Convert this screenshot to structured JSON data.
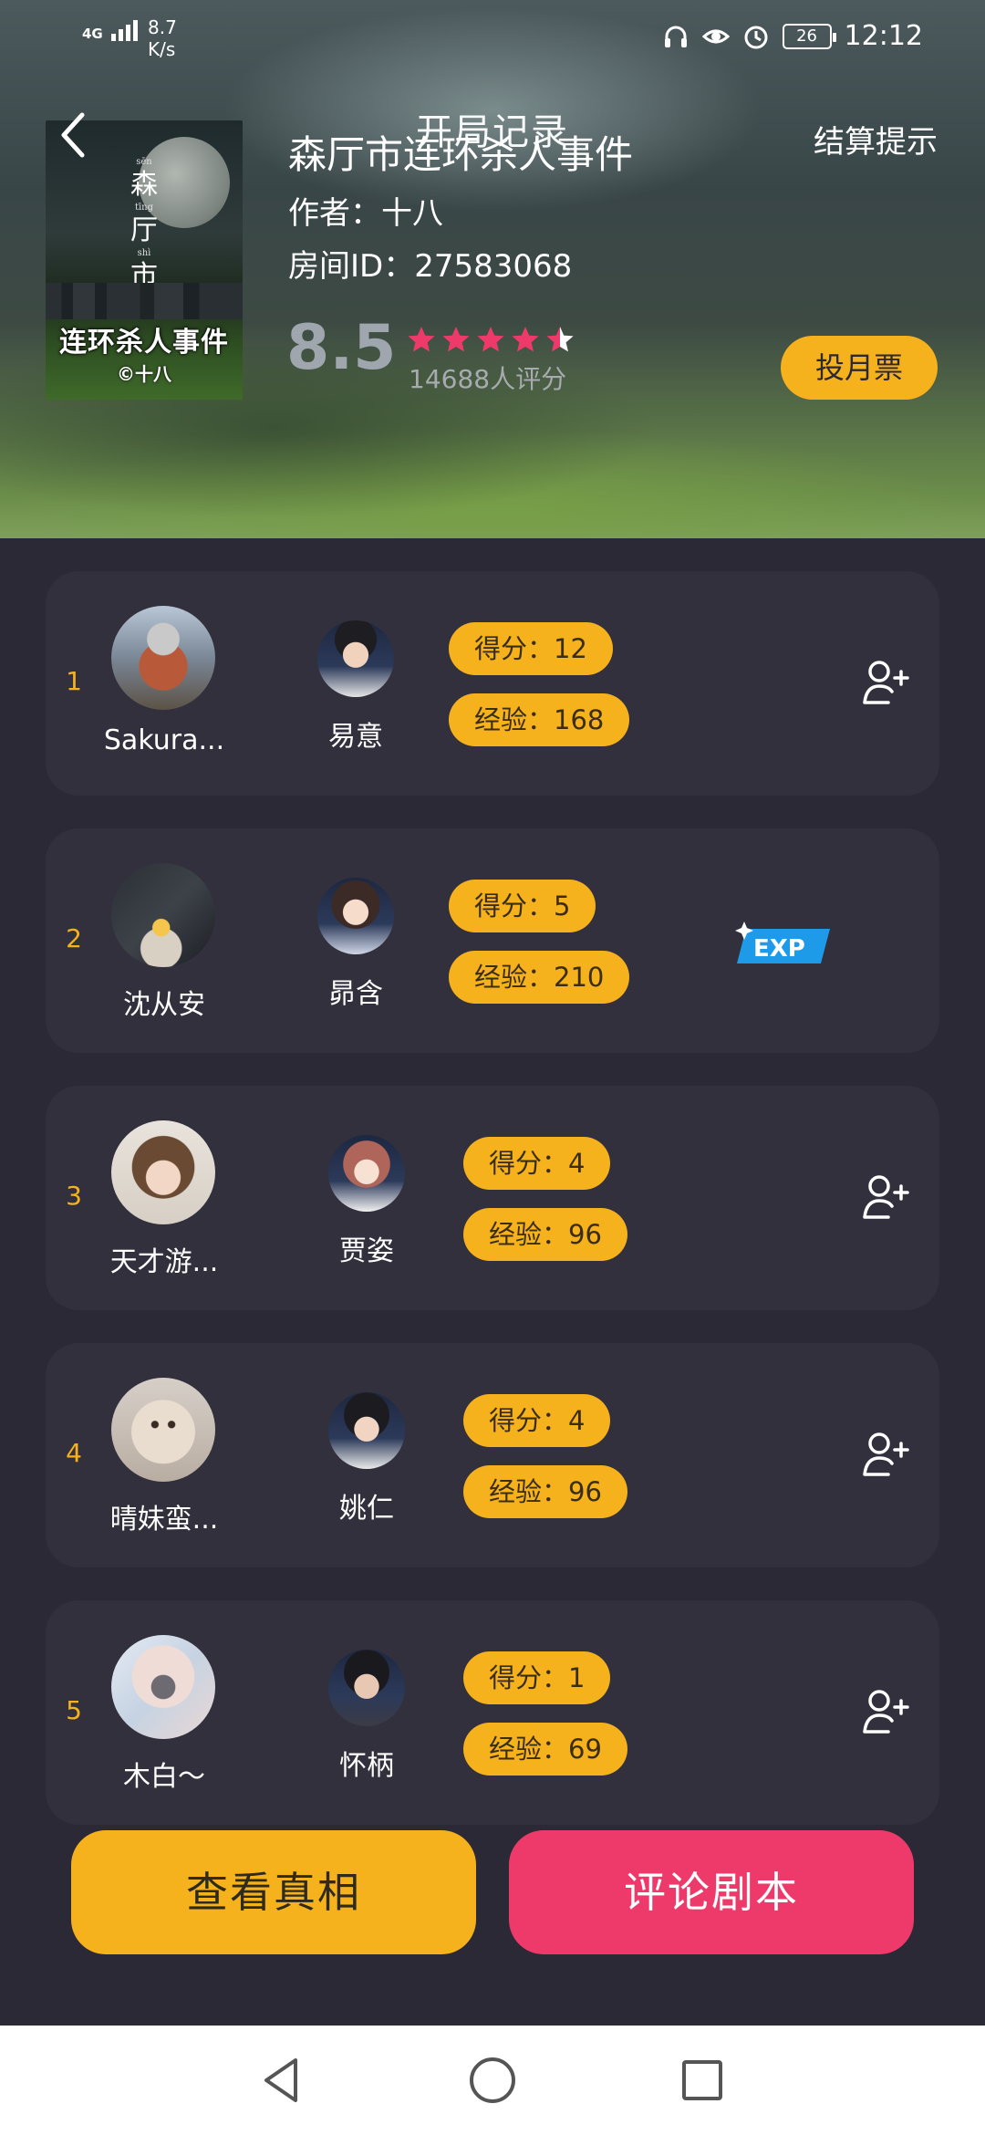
{
  "status_bar": {
    "network": "4G",
    "speed_value": "8.7",
    "speed_unit": "K/s",
    "battery": "26",
    "time": "12:12"
  },
  "header": {
    "title": "开局记录",
    "settle_link": "结算提示"
  },
  "book": {
    "cover_title": "连环杀人事件",
    "cover_vertical": [
      "森",
      "厅",
      "市"
    ],
    "cover_pinyin": [
      "sēn",
      "tīng",
      "shì"
    ],
    "cover_author": "©十八",
    "title": "森厅市连环杀人事件",
    "author": "作者：十八",
    "room_id": "房间ID：27583068",
    "rating": "8.5",
    "rating_stars": 4.5,
    "rating_count": "14688人评分",
    "vote_button": "投月票"
  },
  "players": [
    {
      "rank": "1",
      "player_name": "Sakura...",
      "role_name": "易意",
      "score": "得分：12",
      "exp": "经验：168",
      "action": "add-friend"
    },
    {
      "rank": "2",
      "player_name": "沈从安",
      "role_name": "昴含",
      "score": "得分：5",
      "exp": "经验：210",
      "action": "exp-badge",
      "badge": "EXP"
    },
    {
      "rank": "3",
      "player_name": "天才游...",
      "role_name": "贾姿",
      "score": "得分：4",
      "exp": "经验：96",
      "action": "add-friend"
    },
    {
      "rank": "4",
      "player_name": "晴妹蛮...",
      "role_name": "姚仁",
      "score": "得分：4",
      "exp": "经验：96",
      "action": "add-friend"
    },
    {
      "rank": "5",
      "player_name": "木白～",
      "role_name": "怀柄",
      "score": "得分：1",
      "exp": "经验：69",
      "action": "add-friend"
    }
  ],
  "buttons": {
    "view_truth": "查看真相",
    "review_script": "评论剧本"
  },
  "colors": {
    "accent_yellow": "#f5b21d",
    "accent_pink": "#ee3a6a",
    "card_bg": "#32303d",
    "page_bg": "#2b2935"
  }
}
